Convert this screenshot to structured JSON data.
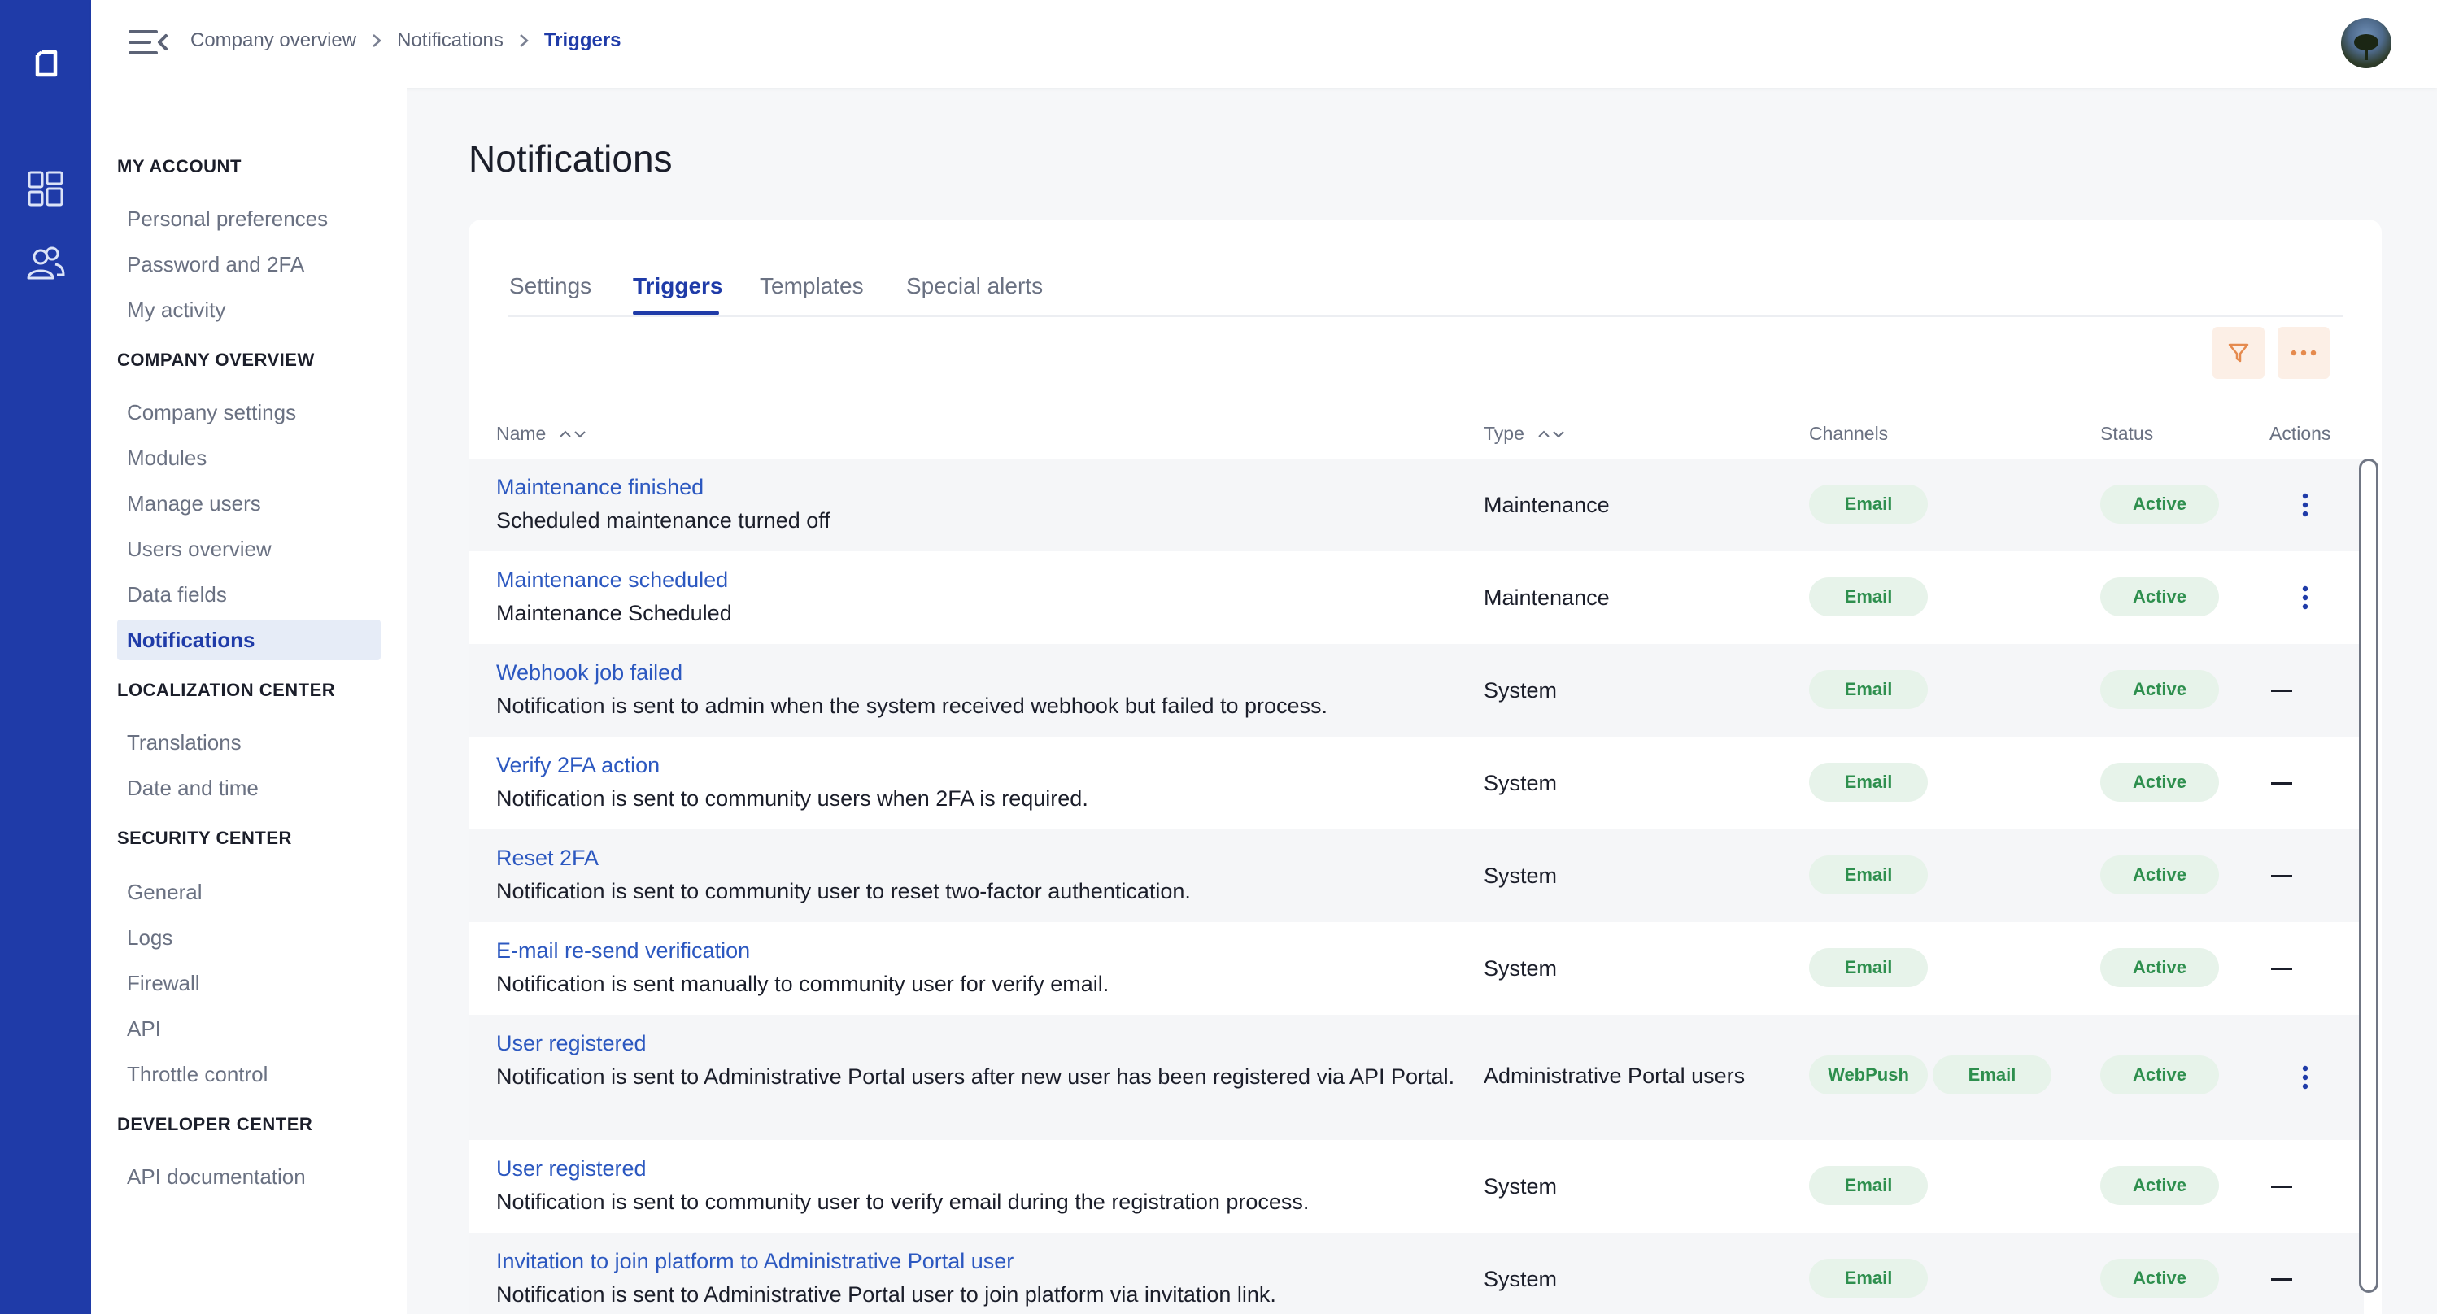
{
  "breadcrumb": [
    "Company overview",
    "Notifications",
    "Triggers"
  ],
  "sidebar": {
    "sections": [
      {
        "title": "MY ACCOUNT",
        "items": [
          "Personal preferences",
          "Password and 2FA",
          "My activity"
        ]
      },
      {
        "title": "COMPANY OVERVIEW",
        "items": [
          "Company settings",
          "Modules",
          "Manage users",
          "Users overview",
          "Data fields",
          "Notifications"
        ]
      },
      {
        "title": "LOCALIZATION CENTER",
        "items": [
          "Translations",
          "Date and time"
        ]
      },
      {
        "title": "SECURITY CENTER",
        "items": [
          "General",
          "Logs",
          "Firewall",
          "API",
          "Throttle control"
        ]
      },
      {
        "title": "DEVELOPER CENTER",
        "items": [
          "API documentation"
        ]
      }
    ],
    "active_item": "Notifications"
  },
  "page_title": "Notifications",
  "tabs": [
    "Settings",
    "Triggers",
    "Templates",
    "Special alerts"
  ],
  "active_tab": "Triggers",
  "table": {
    "headers": {
      "name": "Name",
      "type": "Type",
      "channels": "Channels",
      "status": "Status",
      "actions": "Actions"
    },
    "rows": [
      {
        "title": "Maintenance finished",
        "description": "Scheduled maintenance turned off",
        "type": "Maintenance",
        "channels": [
          "Email"
        ],
        "status": "Active",
        "action": "menu"
      },
      {
        "title": "Maintenance scheduled",
        "description": "Maintenance Scheduled",
        "type": "Maintenance",
        "channels": [
          "Email"
        ],
        "status": "Active",
        "action": "menu"
      },
      {
        "title": "Webhook job failed",
        "description": "Notification is sent to admin when the system received webhook but failed to process.",
        "type": "System",
        "channels": [
          "Email"
        ],
        "status": "Active",
        "action": "none"
      },
      {
        "title": "Verify 2FA action",
        "description": "Notification is sent to community users when 2FA is required.",
        "type": "System",
        "channels": [
          "Email"
        ],
        "status": "Active",
        "action": "none"
      },
      {
        "title": "Reset 2FA",
        "description": "Notification is sent to community user to reset two-factor authentication.",
        "type": "System",
        "channels": [
          "Email"
        ],
        "status": "Active",
        "action": "none"
      },
      {
        "title": "E-mail re-send verification",
        "description": "Notification is sent manually to community user for verify email.",
        "type": "System",
        "channels": [
          "Email"
        ],
        "status": "Active",
        "action": "none"
      },
      {
        "title": "User registered",
        "description": "Notification is sent to Administrative Portal users after new user has been registered via API Portal.",
        "type": "Administrative Portal users",
        "channels": [
          "WebPush",
          "Email"
        ],
        "status": "Active",
        "action": "menu"
      },
      {
        "title": "User registered",
        "description": "Notification is sent to community user to verify email during the registration process.",
        "type": "System",
        "channels": [
          "Email"
        ],
        "status": "Active",
        "action": "none"
      },
      {
        "title": "Invitation to join platform to Administrative Portal user",
        "description": "Notification is sent to Administrative Portal user to join platform via invitation link.",
        "type": "System",
        "channels": [
          "Email"
        ],
        "status": "Active",
        "action": "none"
      }
    ]
  },
  "colors": {
    "rail": "#1f3ba8",
    "accent": "#1f3ba8",
    "link": "#2c58c0",
    "chip_bg": "#e7f3ea",
    "chip_text": "#2e8f4e",
    "toolbar_btn_bg": "#fcefe6",
    "toolbar_icon": "#e58a4e"
  },
  "icons": {
    "rail": [
      "app-logo-icon",
      "dashboard-grid-icon",
      "users-icon"
    ],
    "header": [
      "menu-collapse-icon",
      "chevron-right-icon"
    ],
    "toolbar": [
      "filter-icon",
      "more-horizontal-icon"
    ],
    "row_action": "more-vertical-icon"
  }
}
